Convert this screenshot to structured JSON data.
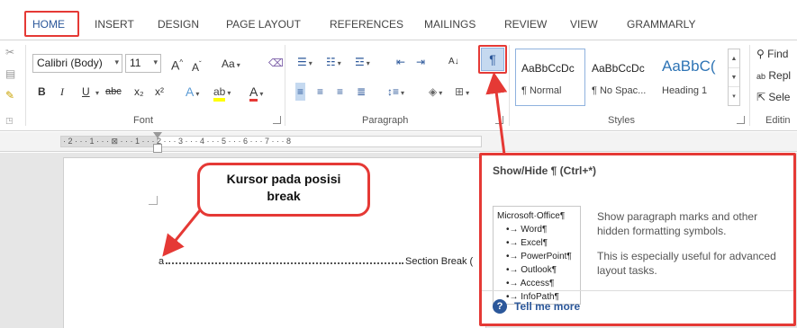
{
  "ribbon_tabs": [
    {
      "label": "HOME"
    },
    {
      "label": "INSERT"
    },
    {
      "label": "DESIGN"
    },
    {
      "label": "PAGE LAYOUT"
    },
    {
      "label": "REFERENCES"
    },
    {
      "label": "MAILINGS"
    },
    {
      "label": "REVIEW"
    },
    {
      "label": "VIEW"
    },
    {
      "label": "GRAMMARLY"
    }
  ],
  "font_group": {
    "font_name": "Calibri (Body)",
    "font_size": "11",
    "label": "Font",
    "grow": "A",
    "shrink": "A",
    "change_case": "Aa",
    "bold": "B",
    "italic": "I",
    "underline": "U",
    "strikethrough": "abc",
    "subscript": "x₂",
    "superscript": "x²",
    "text_effects": "A",
    "font_color": "A"
  },
  "paragraph_group": {
    "label": "Paragraph",
    "show_hide_glyph": "¶",
    "sort_glyph": "A↓"
  },
  "styles_group": {
    "label": "Styles",
    "styles": [
      {
        "sample": "AaBbCcDc",
        "name": "¶ Normal"
      },
      {
        "sample": "AaBbCcDc",
        "name": "¶ No Spac..."
      },
      {
        "sample": "AaBbC(",
        "name": "Heading 1"
      }
    ]
  },
  "editing_group": {
    "label": "Editin",
    "find": "Find",
    "replace": "Repl",
    "select": "Sele"
  },
  "ruler_text": "· 2 · · · 1 · · · ⊠ · · · 1 · · · 2 · · · 3 · · · 4 · · · 5 · · · 6 · · · 7 · · · 8",
  "document": {
    "cursor_char": "a",
    "break_label": "Section Break ("
  },
  "callout": {
    "text_line1": "Kursor pada posisi",
    "text_line2": "break"
  },
  "tooltip": {
    "title": "Show/Hide ¶ (Ctrl+*)",
    "preview_heading": "Microsoft·Office¶",
    "preview_items": [
      "Word¶",
      "Excel¶",
      "PowerPoint¶",
      "Outlook¶",
      "Access¶",
      "InfoPath¶"
    ],
    "desc1": "Show paragraph marks and other hidden formatting symbols.",
    "desc2": "This is especially useful for advanced layout tasks.",
    "help_glyph": "?",
    "link": "Tell me more"
  },
  "colors": {
    "accent": "#2b579a",
    "highlight_red": "#e53935"
  }
}
